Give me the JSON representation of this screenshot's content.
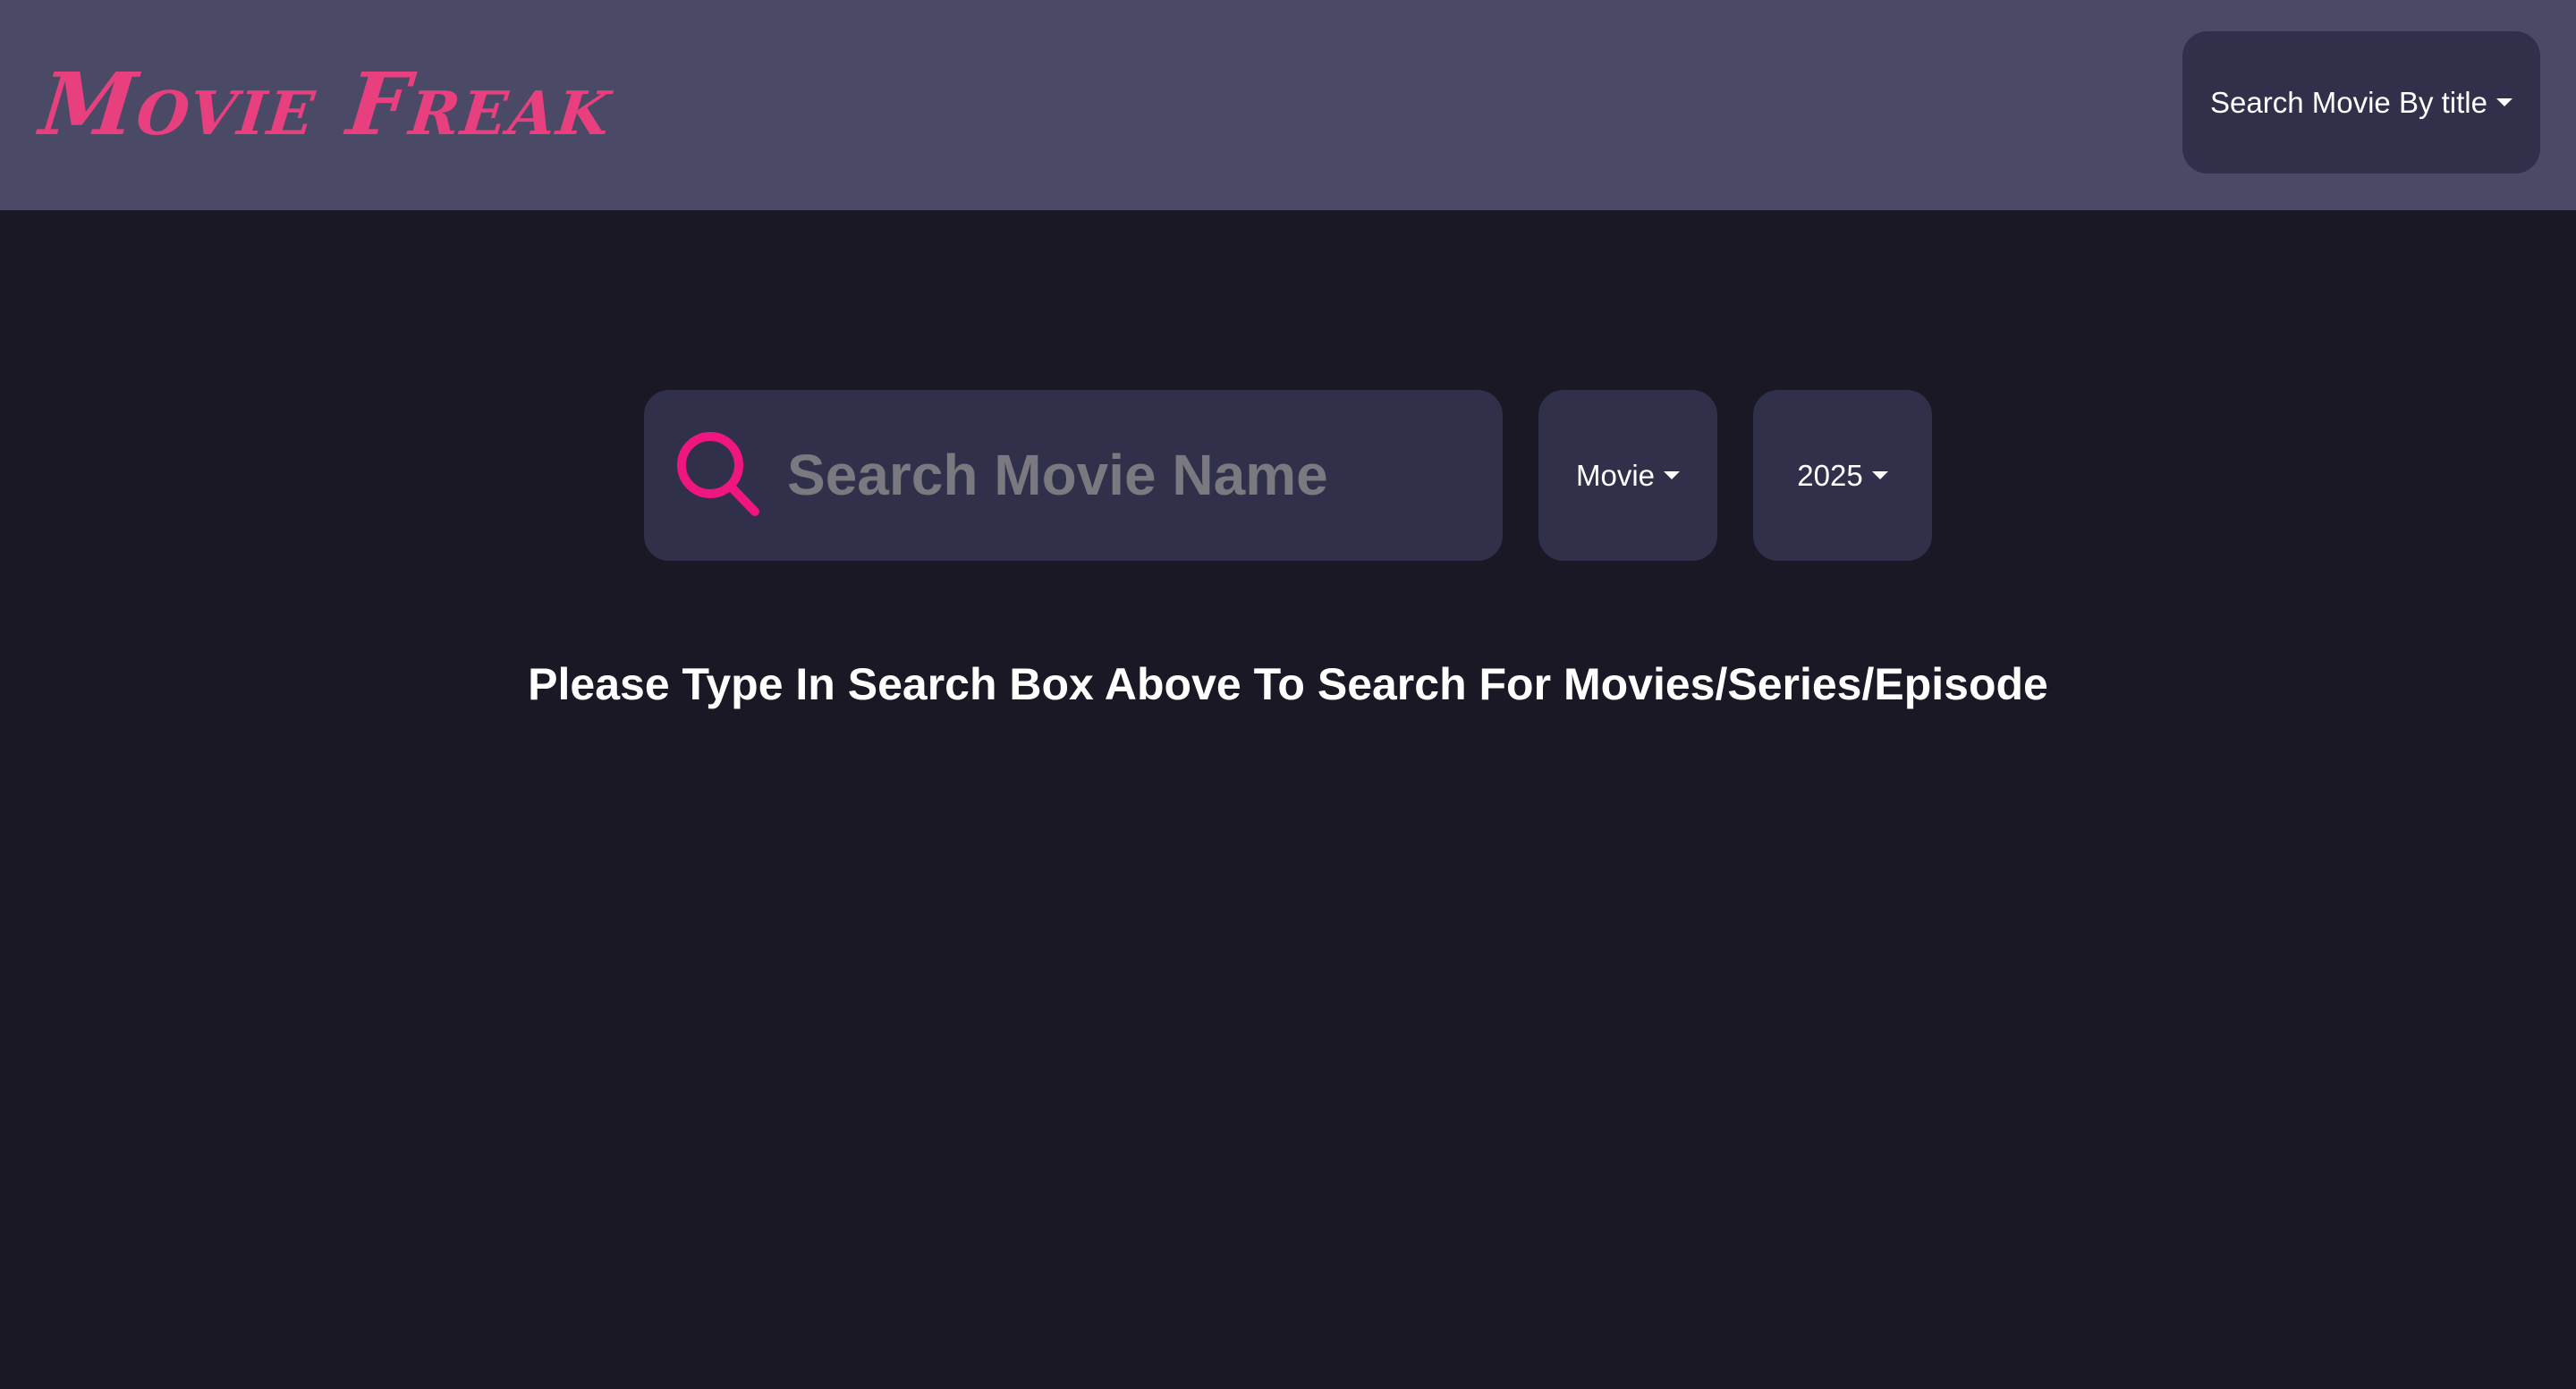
{
  "header": {
    "logo_text": "Movie Freak",
    "search_mode_label": "Search Movie By title"
  },
  "search": {
    "placeholder": "Search Movie Name",
    "value": "",
    "type_selected": "Movie",
    "year_selected": "2025"
  },
  "main": {
    "message": "Please Type In Search Box Above To Search For Movies/Series/Episode"
  },
  "icons": {
    "search": "search-icon",
    "caret": "caret-down-icon"
  },
  "colors": {
    "header_bg": "#4a4966",
    "page_bg": "#191824",
    "control_bg": "#31304b",
    "accent": "#e83f7f",
    "icon_accent": "#f0167f",
    "placeholder": "#7a7980",
    "text": "#ffffff"
  }
}
